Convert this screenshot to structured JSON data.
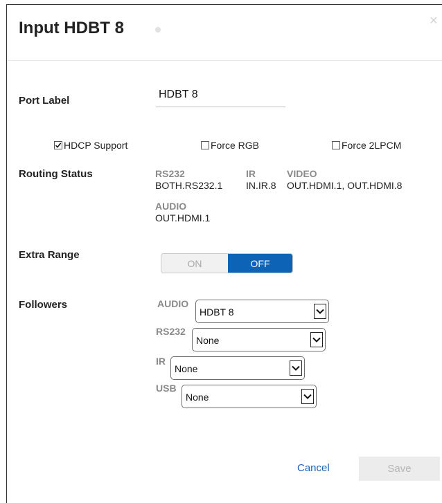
{
  "dialog": {
    "title": "Input HDBT 8",
    "close_glyph": "×"
  },
  "port_label": {
    "label": "Port Label",
    "value": "HDBT 8"
  },
  "options": [
    {
      "label": "HDCP Support",
      "checked": true
    },
    {
      "label": "Force RGB",
      "checked": false
    },
    {
      "label": "Force 2LPCM",
      "checked": false
    }
  ],
  "routing_status": {
    "label": "Routing Status",
    "rs232_head": "RS232",
    "rs232_value": "BOTH.RS232.1",
    "ir_head": "IR",
    "ir_value": "IN.IR.8",
    "video_head": "VIDEO",
    "video_value": "OUT.HDMI.1, OUT.HDMI.8",
    "audio_head": "AUDIO",
    "audio_value": "OUT.HDMI.1"
  },
  "extra_range": {
    "label": "Extra Range",
    "on_label": "ON",
    "off_label": "OFF",
    "selected": "OFF"
  },
  "followers": {
    "label": "Followers",
    "audio": {
      "label": "AUDIO",
      "selected": "HDBT 8"
    },
    "rs232": {
      "label": "RS232",
      "selected": "None"
    },
    "ir": {
      "label": "IR",
      "selected": "None"
    },
    "usb": {
      "label": "USB",
      "selected": "None"
    }
  },
  "footer": {
    "cancel_label": "Cancel",
    "save_label": "Save"
  },
  "colors": {
    "accent": "#0d63b6",
    "link": "#1a63b0",
    "muted_label": "#8a8a8a"
  }
}
